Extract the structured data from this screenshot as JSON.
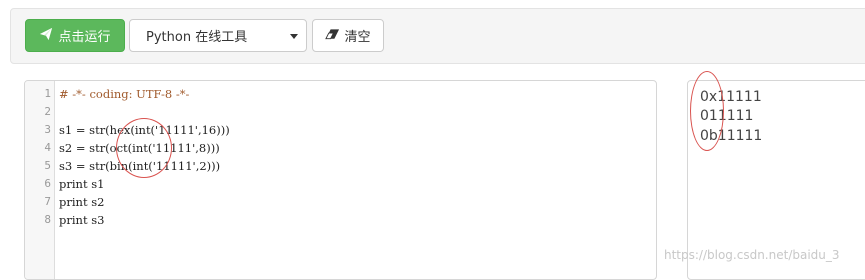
{
  "toolbar": {
    "run_label": "点击运行",
    "language_selected": "Python 在线工具",
    "clear_label": "清空"
  },
  "editor": {
    "line_numbers": [
      "1",
      "2",
      "3",
      "4",
      "5",
      "6",
      "7",
      "8"
    ],
    "lines": [
      "# -*- coding: UTF-8 -*-",
      "",
      "s1 = str(hex(int('11111',16)))",
      "s2 = str(oct(int('11111',8)))",
      "s3 = str(bin(int('11111',2)))",
      "print s1",
      "print s2",
      "print s3"
    ]
  },
  "output": {
    "lines": [
      "0x11111",
      "011111",
      "0b11111"
    ]
  },
  "watermark": "https://blog.csdn.net/baidu_3",
  "colors": {
    "run_button": "#5cb85c",
    "annotation_circle": "#d9534f",
    "comment": "#a05a2c"
  }
}
